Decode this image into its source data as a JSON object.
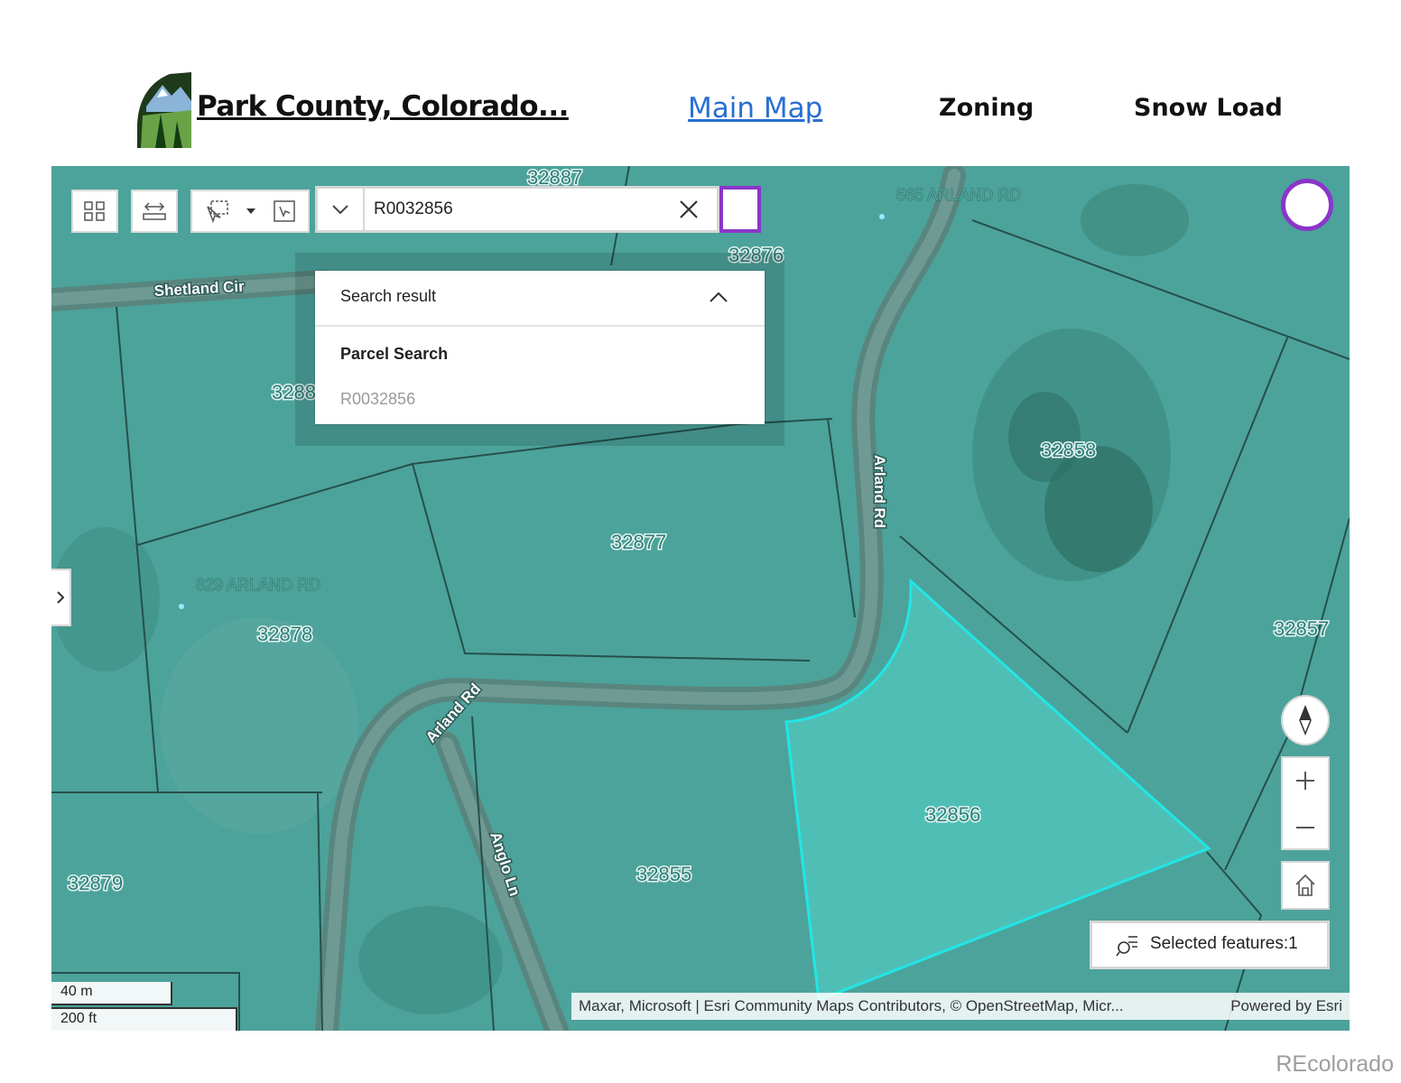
{
  "header": {
    "site_title": "Park County, Colorado...",
    "nav": [
      {
        "label": "Main Map",
        "active": true
      },
      {
        "label": "Zoning",
        "active": false
      },
      {
        "label": "Snow Load",
        "active": false
      }
    ]
  },
  "map": {
    "search": {
      "value": "R0032856"
    },
    "results": {
      "title": "Search result",
      "group": "Parcel Search",
      "item": "R0032856"
    },
    "selected_features_label": "Selected features:1",
    "scale": {
      "metric": "40 m",
      "imperial": "200 ft"
    },
    "attribution": "Maxar, Microsoft | Esri Community Maps Contributors, © OpenStreetMap, Micr...",
    "powered_by": "Powered by Esri",
    "parcels": [
      "32887",
      "32876",
      "3288",
      "32877",
      "32858",
      "32878",
      "32857",
      "32856",
      "32855",
      "32879"
    ],
    "roads": [
      "Shetland Cir",
      "Arland Rd",
      "Arland Rd",
      "Anglo Ln"
    ],
    "addresses": [
      "565 ARLAND RD",
      "829 ARLAND RD"
    ],
    "colors": {
      "accent": "#8a35c9",
      "selection": "#21e6e6",
      "imagery": "#4ca39b",
      "link": "#2a6fd1"
    }
  },
  "watermark": "REcolorado"
}
